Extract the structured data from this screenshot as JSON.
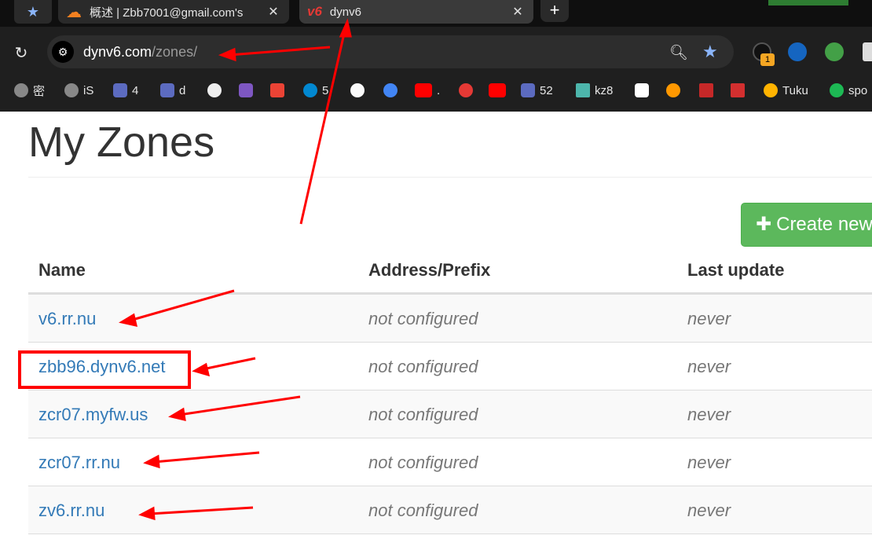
{
  "browser": {
    "tabs": [
      {
        "title": "概述 | Zbb7001@gmail.com's",
        "close": "✕"
      },
      {
        "favicon_text": "v6",
        "title": "dynv6",
        "close": "✕"
      }
    ],
    "new_tab": "+",
    "address": {
      "host": "dynv6.com",
      "path": "/zones/"
    },
    "extension_badge": "1",
    "bookmarks": [
      "密",
      "iS",
      "4",
      "d",
      "",
      "",
      "",
      "5",
      "",
      "",
      ".",
      "",
      "",
      "52",
      "kz8",
      "",
      "",
      "",
      "",
      "Tuku",
      "spo"
    ],
    "colors": {
      "accent": "#8ab4f8",
      "frame": "#1f1f1f"
    }
  },
  "page": {
    "title": "My Zones",
    "create_button": "Create new",
    "table": {
      "headers": {
        "name": "Name",
        "address": "Address/Prefix",
        "updated": "Last update"
      },
      "rows": [
        {
          "name": "v6.rr.nu",
          "address": "not configured",
          "updated": "never"
        },
        {
          "name": "zbb96.dynv6.net",
          "address": "not configured",
          "updated": "never"
        },
        {
          "name": "zcr07.myfw.us",
          "address": "not configured",
          "updated": "never"
        },
        {
          "name": "zcr07.rr.nu",
          "address": "not configured",
          "updated": "never"
        },
        {
          "name": "zv6.rr.nu",
          "address": "not configured",
          "updated": "never"
        }
      ]
    },
    "colors": {
      "link": "#337ab7",
      "button": "#5cb85c",
      "annotation": "#ff0000"
    }
  }
}
